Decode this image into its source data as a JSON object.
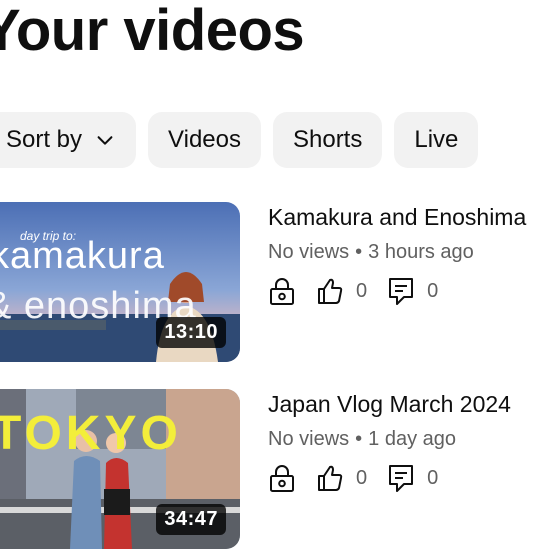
{
  "header": {
    "title": "Your videos"
  },
  "filters": [
    {
      "label": "Sort by",
      "icon": "chevron-down-icon"
    },
    {
      "label": "Videos"
    },
    {
      "label": "Shorts"
    },
    {
      "label": "Live"
    }
  ],
  "videos": [
    {
      "title": "Kamakura and Enoshima",
      "views": "No views",
      "age": "3 hours ago",
      "duration": "13:10",
      "thumb_line1": "day trip to:",
      "thumb_line2": "kamakura",
      "thumb_line3": "& enoshima",
      "likes": "0",
      "comments": "0"
    },
    {
      "title": "Japan Vlog March 2024",
      "views": "No views",
      "age": "1 day ago",
      "duration": "34:47",
      "thumb_line1": "TOKYO",
      "likes": "0",
      "comments": "0"
    }
  ],
  "colors": {
    "text": "#0f0f0f",
    "secondary": "#606060",
    "chip_bg": "#f2f2f2",
    "accent_yellow": "#f3ee3a"
  }
}
